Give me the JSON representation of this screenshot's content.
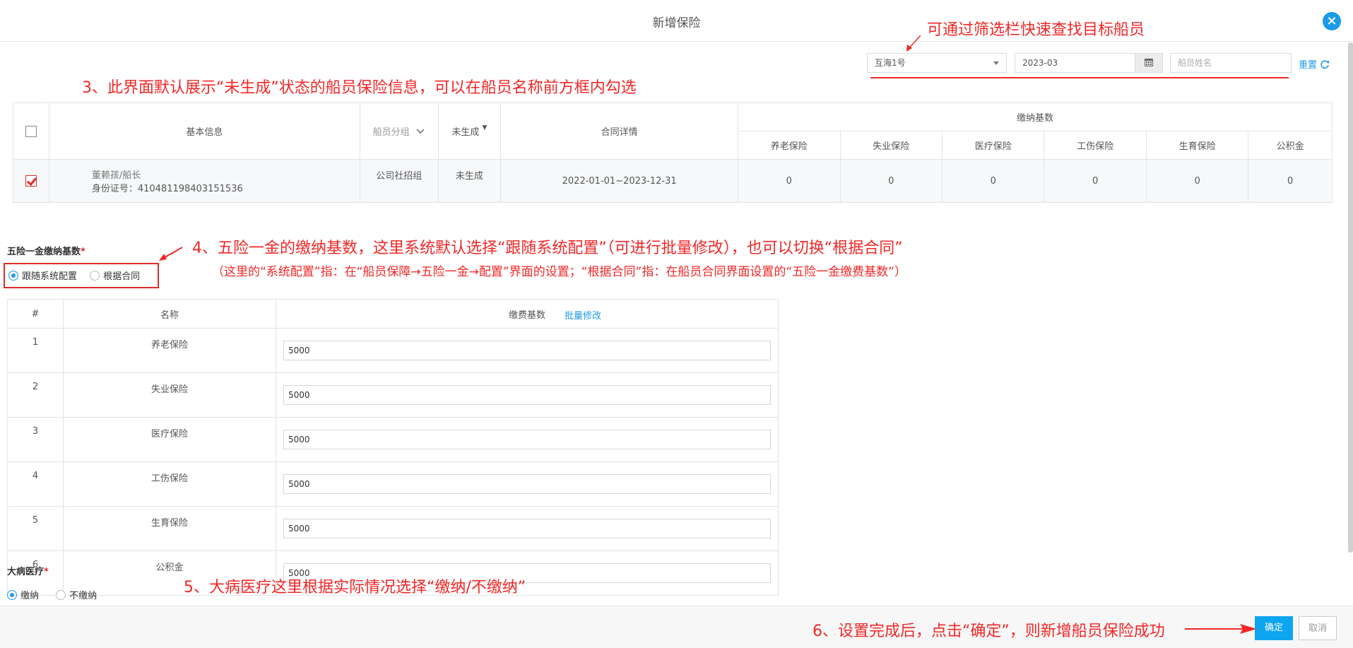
{
  "dialog": {
    "title": "新增保险",
    "close_icon": "×"
  },
  "filters": {
    "ship": "互海1号",
    "month": "2023-03",
    "name_placeholder": "船员姓名",
    "reset_label": "重置"
  },
  "annotations": {
    "filter_tip": "可通过筛选栏快速查找目标船员",
    "step3": "3、此界面默认展示“未生成”状态的船员保险信息，可以在船员名称前方框内勾选",
    "step4": "4、五险一金的缴纳基数，这里系统默认选择“跟随系统配置”（可进行批量修改），也可以切换“根据合同”",
    "step4_sub": "（这里的“系统配置”指：在“船员保障→五险一金→配置”界面的设置；“根据合同”指：在船员合同界面设置的“五险一金缴费基数”）",
    "step5": "5、大病医疗这里根据实际情况选择“缴纳/不缴纳”",
    "step6": "6、设置完成后，点击“确定”，则新增船员保险成功"
  },
  "crew_table": {
    "headers": {
      "basic_info": "基本信息",
      "group": "船员分组",
      "status": "未生成",
      "contract": "合同详情",
      "base_group": "缴纳基数",
      "base_cols": [
        "养老保险",
        "失业保险",
        "医疗保险",
        "工伤保险",
        "生育保险",
        "公积金"
      ]
    },
    "rows": [
      {
        "name_role": "董赖孩/船长",
        "id_line": "身份证号：410481198403151536",
        "group": "公司社招组",
        "status": "未生成",
        "contract": "2022-01-01~2023-12-31",
        "bases": [
          "0",
          "0",
          "0",
          "0",
          "0",
          "0"
        ],
        "checked": true
      }
    ]
  },
  "five_insurance": {
    "label": "五险一金缴纳基数",
    "required_mark": "*",
    "options": [
      "跟随系统配置",
      "根据合同"
    ],
    "selected": "跟随系统配置",
    "table_headers": {
      "index": "#",
      "name": "名称",
      "base": "缴费基数",
      "batch_edit": "批量修改"
    },
    "rows": [
      {
        "index": "1",
        "name": "养老保险",
        "value": "5000"
      },
      {
        "index": "2",
        "name": "失业保险",
        "value": "5000"
      },
      {
        "index": "3",
        "name": "医疗保险",
        "value": "5000"
      },
      {
        "index": "4",
        "name": "工伤保险",
        "value": "5000"
      },
      {
        "index": "5",
        "name": "生育保险",
        "value": "5000"
      },
      {
        "index": "6",
        "name": "公积金",
        "value": "5000"
      }
    ]
  },
  "serious_illness": {
    "label": "大病医疗",
    "required_mark": "*",
    "options": [
      "缴纳",
      "不缴纳"
    ],
    "selected": "缴纳"
  },
  "footer": {
    "confirm_label": "确定",
    "cancel_label": "取消"
  },
  "colors": {
    "accent": "#1b9ae8",
    "annotation_red": "#f12727",
    "confirm": "#0ea5f0"
  }
}
